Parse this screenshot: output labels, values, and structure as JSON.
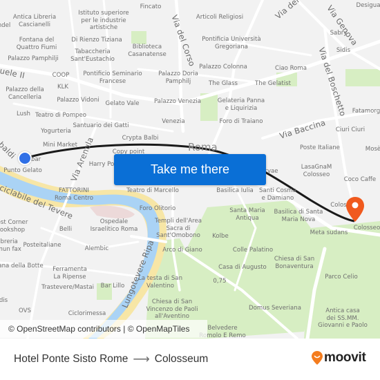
{
  "map": {
    "city_label": "Roma",
    "attribution": "© OpenStreetMap contributors | © OpenMapTiles",
    "colors": {
      "background": "#f2f2f2",
      "road": "#ffffff",
      "water": "#aad3f5",
      "river_bank": "#f7e6a6",
      "park": "#d7eec3",
      "route_line": "#1a1a1a",
      "origin_marker": "#2f6fe6",
      "destination_marker": "#f05a1e",
      "cta_button": "#0a6fd6"
    },
    "streets": [
      {
        "name": "Via del Corso"
      },
      {
        "name": "Via Genova"
      },
      {
        "name": "Via del Boschetto"
      },
      {
        "name": "Via Baccina"
      },
      {
        "name": "Via Arenula"
      },
      {
        "name": "Lungotevere Ripa"
      },
      {
        "name": "ciclabile del Tevere"
      },
      {
        "name": "uele II"
      },
      {
        "name": "baldi"
      },
      {
        "name": "Via dei"
      }
    ],
    "pois": [
      "Antica Libreria\nCascianelli",
      "ndel",
      "Istituto superiore\nper le industrie\nartistiche",
      "Fincato",
      "Articoli Religiosi",
      "Desigua",
      "Sabry",
      "Sidis",
      "Fontana del\nQuattro Fiumi",
      "Di Rienzo Tiziana",
      "Biblioteca\nCasanatense",
      "Pontificia Università\nGregoriana",
      "Palazzo Pamphilji",
      "Tabaccheria\nSant'Eustachio",
      "Palazzo Colonna",
      "Ciao Roma",
      "COOP",
      "Pontificio Seminario\nFrancese",
      "Palazzo Doria\nPamphilj",
      "The Glass",
      "The Gelatist",
      "KLK",
      "Palazzo della\nCancelleria",
      "Palazzo Vidoni",
      "Gelato Vale",
      "Palazzo Venezia",
      "Gelateria Panna\ne Liquirizia",
      "Fatamorg",
      "Lush",
      "Teatro di Pompeo",
      "Venezia",
      "Foro di Traiano",
      "Ciuri Ciuri",
      "Santuario dei Gatti",
      "Yogurteria",
      "Crypta Balbi",
      "Poste Italiane",
      "Mosè",
      "Mini Market",
      "Copy point",
      "Harry Po",
      "LasaGnaM\nColosseo",
      "Punto Gelato",
      "bar",
      "Coco Caffe",
      "Teatro di Marcello",
      "FATTORINI\nRoma Centro",
      "Basilica Iulia",
      "Santi Cosma\ne Damiano",
      "Colos",
      "Foro Olitorio",
      "Santa Maria\nAntiqua",
      "Basilica di Santa\nMaria Nova",
      "Colosseo",
      "Meta sudans",
      "ost Corner\nookshop",
      "Ospedale\nIsraelitico Roma",
      "Templi dell'Area\nSacra di\nSant'Omobono",
      "Belli",
      "ibreria\nimun fax",
      "Posteitaliane",
      "Kolbe",
      "Alembic",
      "Arco di Giano",
      "Colle Palatino",
      "Chiesa di San\nBonaventura",
      "ana della Botte",
      "Ferramenta\nLa Ripense",
      "Casa di Augusto",
      "Parco Celio",
      "Trastevere/Mastai",
      "Bar Lillo",
      "La testa di San\nValentino",
      "0,75",
      "dis",
      "Domus Severiana",
      "Chiesa di San\nVincenzo de Paoli\nall'Aventino",
      "OVS",
      "Ciclorimessa",
      "Antica casa\ndei SS.MM.\nGiovanni e Paolo",
      "Belvedere\nRomolo E Remo",
      "rvae"
    ]
  },
  "cta": {
    "label": "Take me there"
  },
  "route": {
    "origin": "Hotel Ponte Sisto Rome",
    "destination": "Colosseum",
    "arrow_icon": "arrow-right-icon"
  },
  "brand": {
    "name": "moovit",
    "logo_icon": "moovit-pin-icon",
    "color": "#f47c1e"
  }
}
